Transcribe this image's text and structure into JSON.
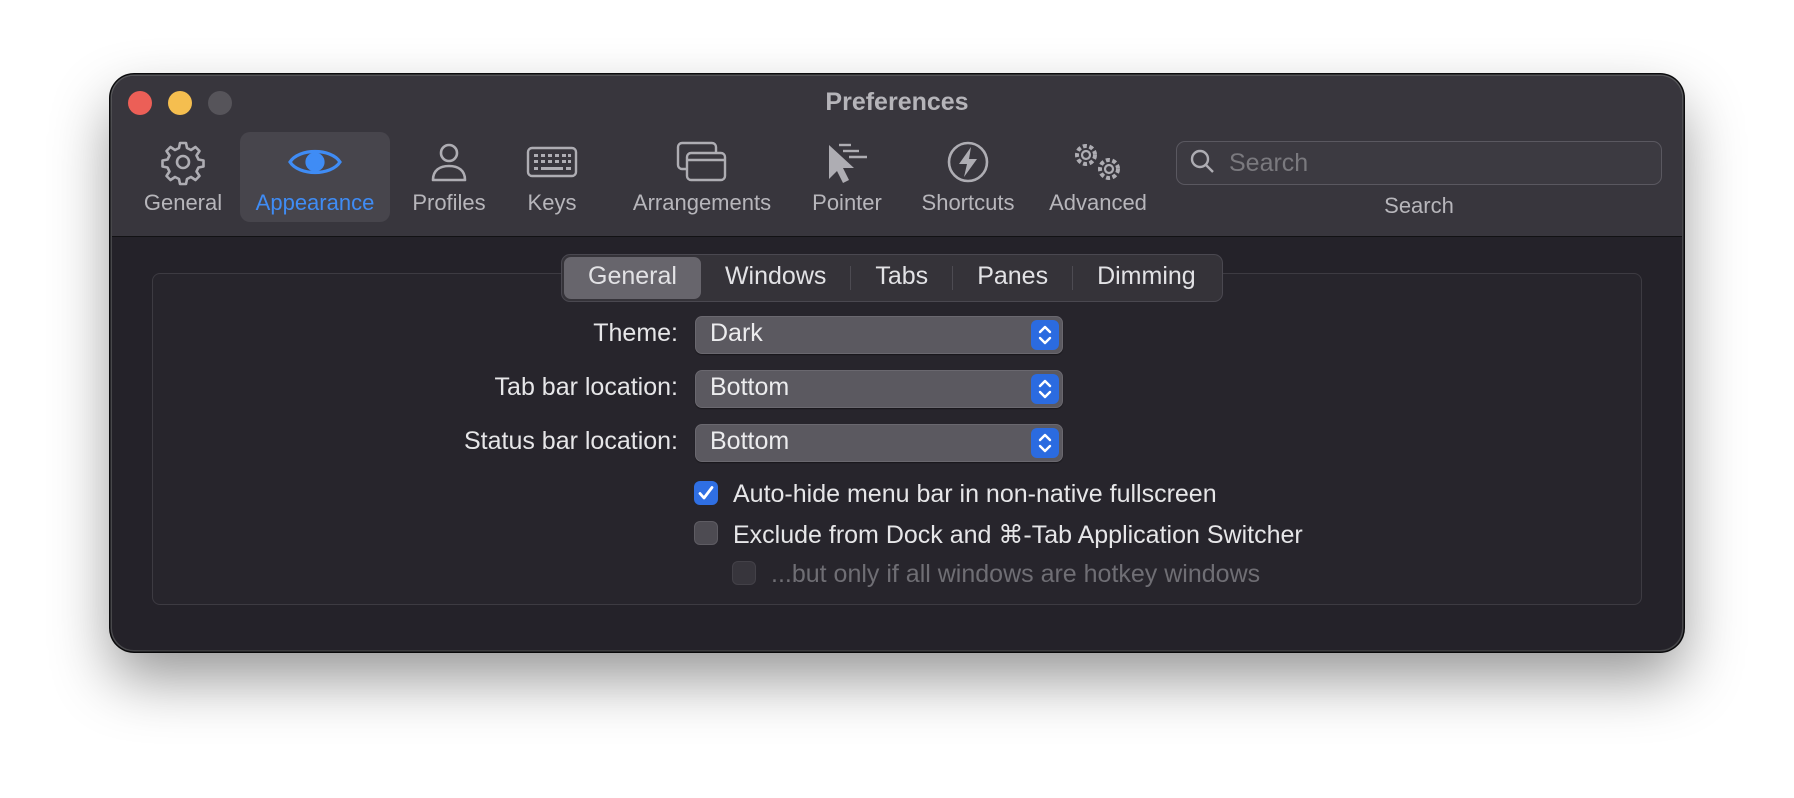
{
  "window": {
    "title": "Preferences"
  },
  "toolbar": {
    "items": [
      {
        "label": "General",
        "icon": "gear-icon"
      },
      {
        "label": "Appearance",
        "icon": "eye-icon",
        "active": true
      },
      {
        "label": "Profiles",
        "icon": "person-icon"
      },
      {
        "label": "Keys",
        "icon": "keyboard-icon"
      },
      {
        "label": "Arrangements",
        "icon": "windows-icon"
      },
      {
        "label": "Pointer",
        "icon": "pointer-icon"
      },
      {
        "label": "Shortcuts",
        "icon": "bolt-icon"
      },
      {
        "label": "Advanced",
        "icon": "gears-icon"
      }
    ],
    "search": {
      "placeholder": "Search",
      "label": "Search"
    }
  },
  "tabs": [
    {
      "label": "General",
      "selected": true
    },
    {
      "label": "Windows"
    },
    {
      "label": "Tabs"
    },
    {
      "label": "Panes"
    },
    {
      "label": "Dimming"
    }
  ],
  "settings": {
    "theme": {
      "label": "Theme:",
      "value": "Dark"
    },
    "tab_bar": {
      "label": "Tab bar location:",
      "value": "Bottom"
    },
    "status_bar": {
      "label": "Status bar location:",
      "value": "Bottom"
    },
    "auto_hide": {
      "label": "Auto-hide menu bar in non-native fullscreen",
      "checked": true
    },
    "exclude_dock": {
      "label": "Exclude from Dock and ⌘-Tab Application Switcher",
      "checked": false
    },
    "hotkey_only": {
      "label": "...but only if all windows are hotkey windows",
      "checked": false,
      "enabled": false
    }
  },
  "colors": {
    "accent": "#3f8cf5",
    "checkbox": "#2f6fe3",
    "window_bg": "#242229",
    "titlebar_bg": "#38363d"
  }
}
